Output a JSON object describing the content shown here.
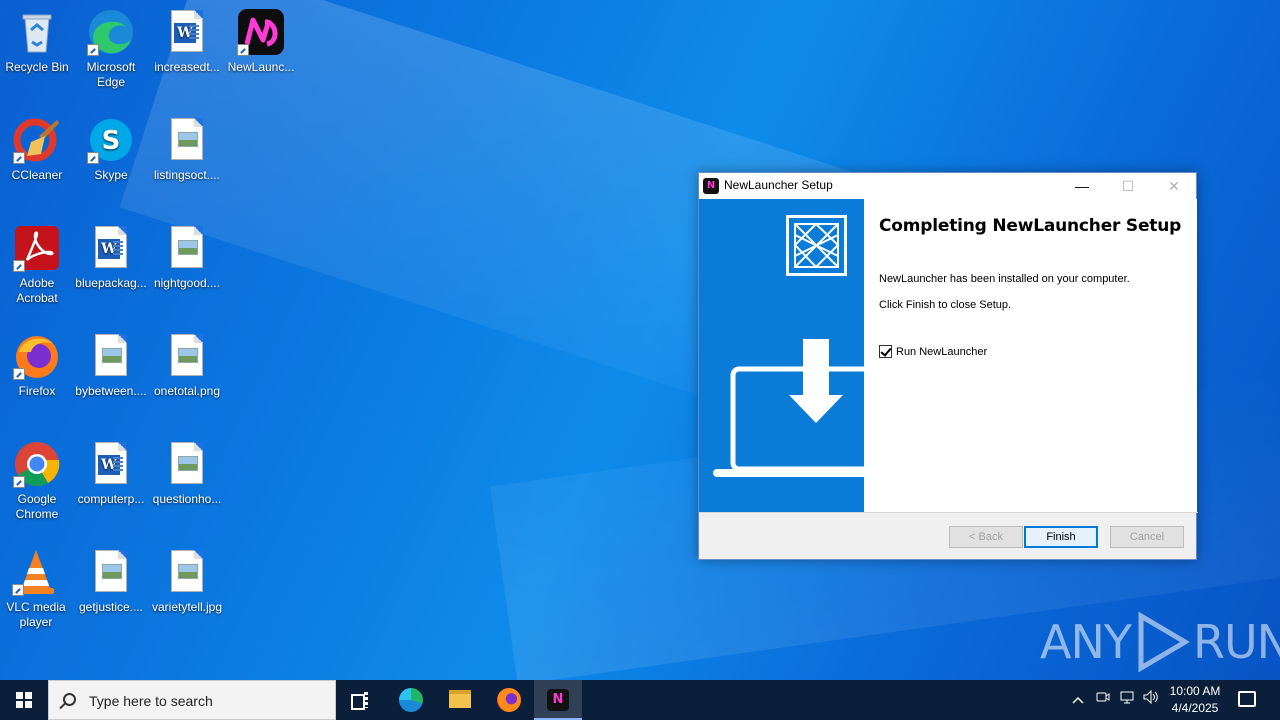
{
  "desktop": {
    "icons": [
      {
        "label": "Recycle Bin",
        "icon": "recycle-bin-icon"
      },
      {
        "label": "Microsoft Edge",
        "icon": "edge-icon"
      },
      {
        "label": "increasedt...",
        "icon": "word-doc-icon"
      },
      {
        "label": "NewLaunc...",
        "icon": "newlauncher-icon"
      },
      {
        "label": "CCleaner",
        "icon": "ccleaner-icon"
      },
      {
        "label": "Skype",
        "icon": "skype-icon"
      },
      {
        "label": "listingsoct....",
        "icon": "image-file-icon"
      },
      {
        "label": "Adobe Acrobat",
        "icon": "acrobat-icon"
      },
      {
        "label": "bluepackag...",
        "icon": "word-doc-icon"
      },
      {
        "label": "nightgood....",
        "icon": "image-file-icon"
      },
      {
        "label": "Firefox",
        "icon": "firefox-icon"
      },
      {
        "label": "bybetween....",
        "icon": "image-file-icon"
      },
      {
        "label": "onetotal.png",
        "icon": "image-file-icon"
      },
      {
        "label": "Google Chrome",
        "icon": "chrome-icon"
      },
      {
        "label": "computerp...",
        "icon": "word-doc-icon"
      },
      {
        "label": "questionho...",
        "icon": "image-file-icon"
      },
      {
        "label": "VLC media player",
        "icon": "vlc-icon"
      },
      {
        "label": "getjustice....",
        "icon": "image-file-icon"
      },
      {
        "label": "varietytell.jpg",
        "icon": "image-file-icon"
      }
    ]
  },
  "setup_window": {
    "title": "NewLauncher Setup",
    "heading": "Completing NewLauncher Setup",
    "message1": "NewLauncher has been installed on your computer.",
    "message2": "Click Finish to close Setup.",
    "checkbox_label": "Run NewLauncher",
    "checkbox_checked": true,
    "back_label": "< Back",
    "finish_label": "Finish",
    "cancel_label": "Cancel",
    "panel_color": "#0a7bd6"
  },
  "taskbar": {
    "search_placeholder": "Type here to search",
    "time": "10:00 AM",
    "date": "4/4/2025"
  },
  "watermark": {
    "left": "ANY",
    "right": "RUN"
  }
}
